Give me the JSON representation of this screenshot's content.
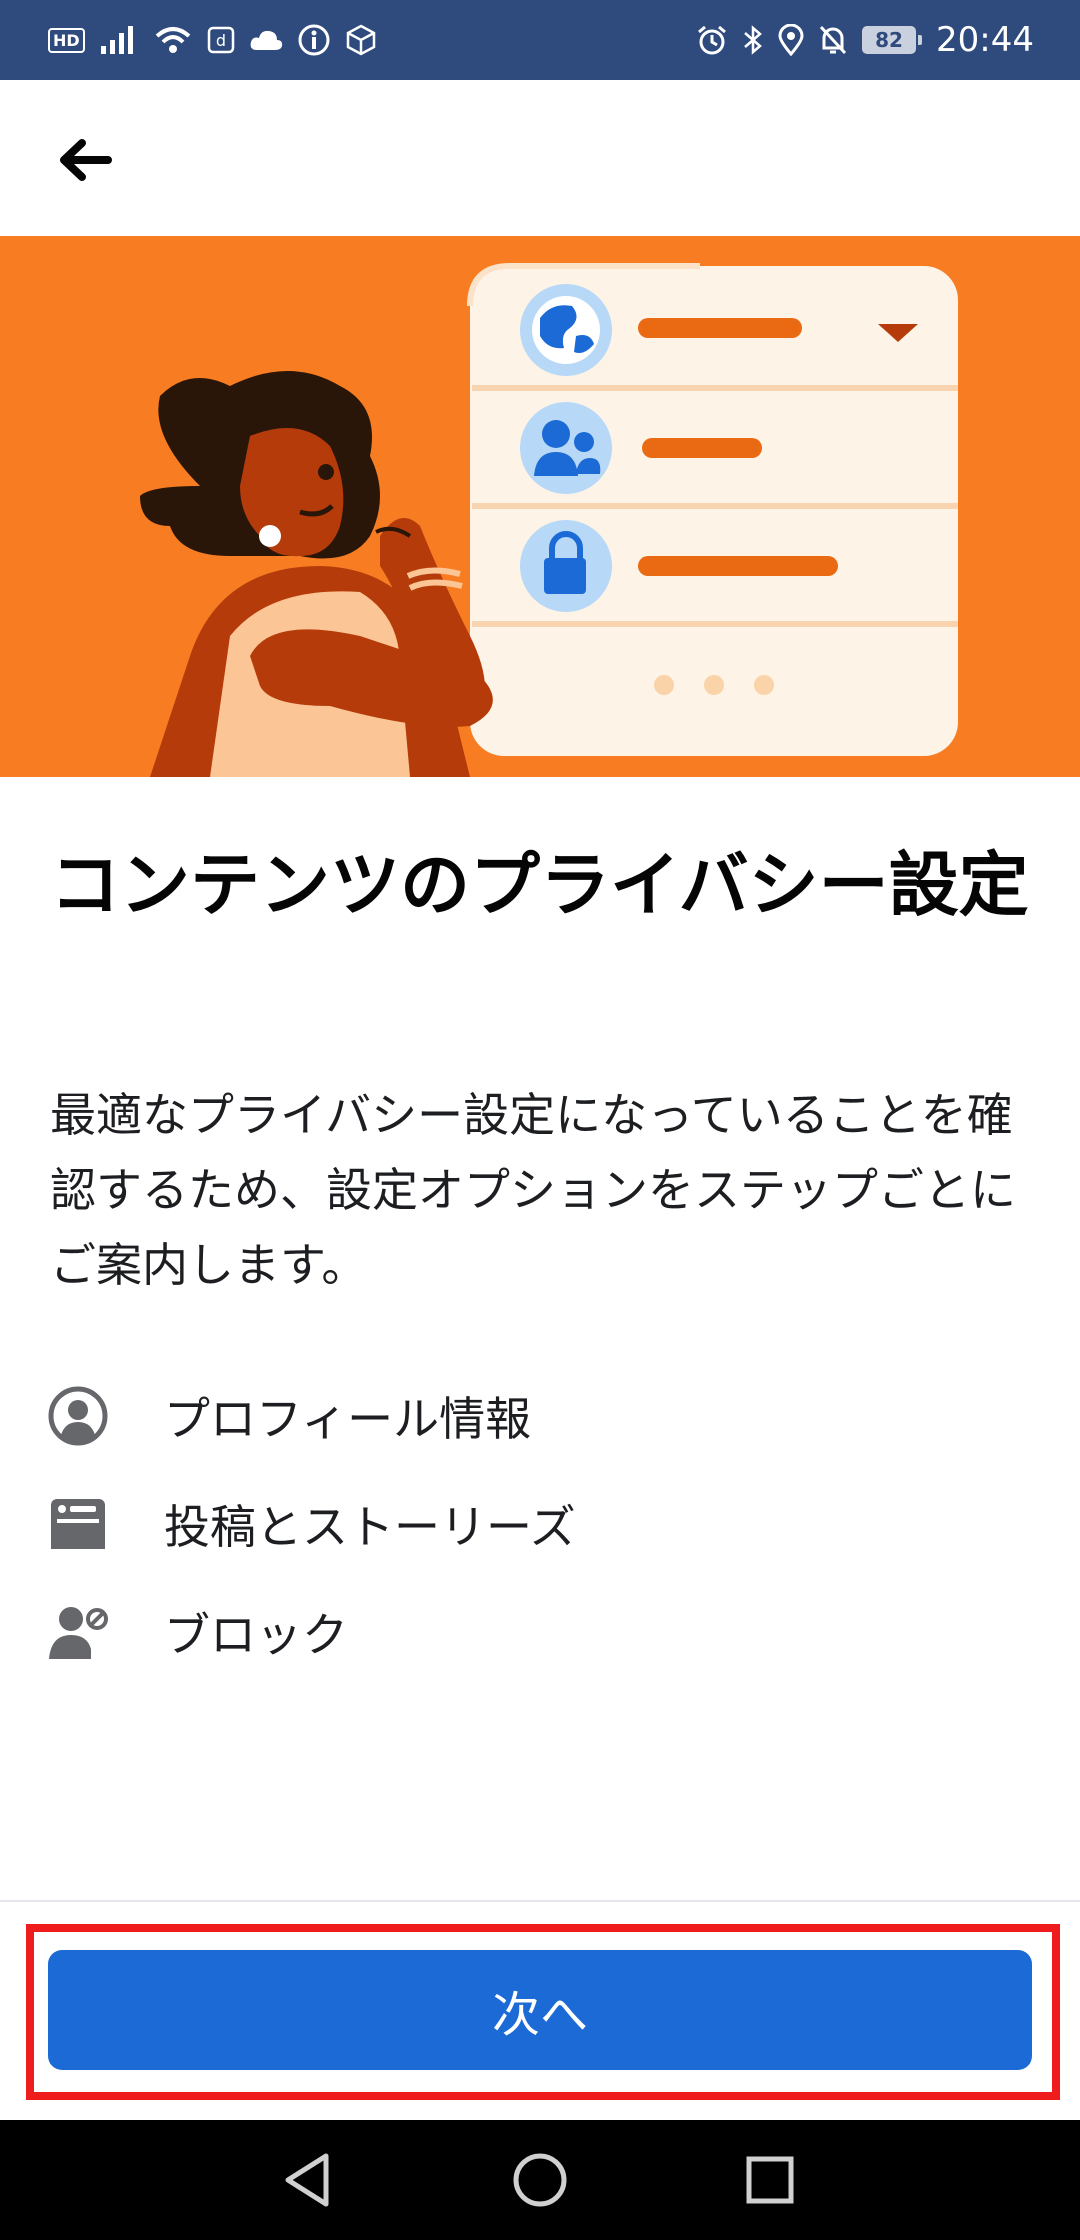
{
  "status_bar": {
    "hd_label": "HD",
    "battery": "82",
    "time": "20:44",
    "left_icons": [
      "hd-icon",
      "signal-icon",
      "wifi-icon",
      "docomo-icon",
      "cloud-icon",
      "info-icon",
      "box-icon"
    ],
    "right_icons": [
      "alarm-icon",
      "bluetooth-icon",
      "location-icon",
      "mute-bell-icon",
      "battery-icon"
    ],
    "color": "#2f4a7d"
  },
  "app_bar": {
    "back_icon": "arrow-left-icon"
  },
  "hero": {
    "background": "#f87d22",
    "card_items": [
      "globe-icon",
      "people-icon",
      "lock-icon"
    ]
  },
  "content": {
    "title": "コンテンツのプライバシー設定",
    "description": "最適なプライバシー設定になっていることを確認するため、設定オプションをステップごとにご案内します。",
    "features": [
      {
        "icon": "profile-icon",
        "label": "プロフィール情報"
      },
      {
        "icon": "posts-icon",
        "label": "投稿とストーリーズ"
      },
      {
        "icon": "block-user-icon",
        "label": "ブロック"
      }
    ]
  },
  "footer": {
    "next_label": "次へ",
    "button_color": "#1b6ad6",
    "highlight_color": "#ee1c1c"
  },
  "nav_bar": {
    "items": [
      "back-triangle-icon",
      "home-circle-icon",
      "recents-square-icon"
    ]
  }
}
